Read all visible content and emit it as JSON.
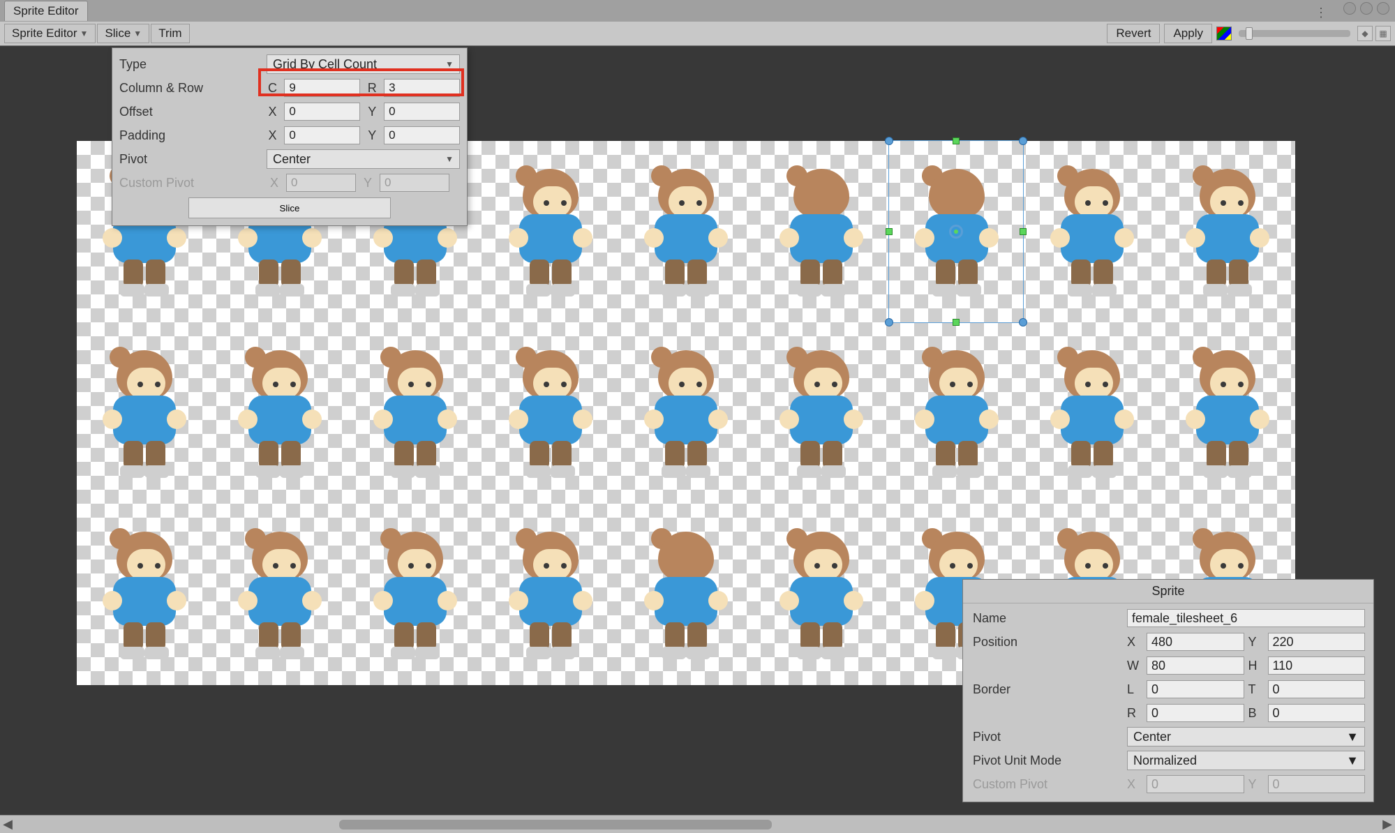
{
  "tabs": {
    "main": "Sprite Editor"
  },
  "toolbar": {
    "sprite_editor": "Sprite Editor",
    "slice": "Slice",
    "trim": "Trim",
    "revert": "Revert",
    "apply": "Apply"
  },
  "slice_popup": {
    "type_label": "Type",
    "type_value": "Grid By Cell Count",
    "col_row_label": "Column & Row",
    "col_prefix": "C",
    "col_value": "9",
    "row_prefix": "R",
    "row_value": "3",
    "offset_label": "Offset",
    "offset_x": "0",
    "offset_y": "0",
    "padding_label": "Padding",
    "padding_x": "0",
    "padding_y": "0",
    "pivot_label": "Pivot",
    "pivot_value": "Center",
    "custom_pivot_label": "Custom Pivot",
    "custom_x": "0",
    "custom_y": "0",
    "x_prefix": "X",
    "y_prefix": "Y",
    "slice_button": "Slice"
  },
  "inspector": {
    "title": "Sprite",
    "name_label": "Name",
    "name_value": "female_tilesheet_6",
    "position_label": "Position",
    "X": "X",
    "Y": "Y",
    "W": "W",
    "H": "H",
    "pos_x": "480",
    "pos_y": "220",
    "pos_w": "80",
    "pos_h": "110",
    "border_label": "Border",
    "L": "L",
    "T": "T",
    "R": "R",
    "B": "B",
    "border_l": "0",
    "border_t": "0",
    "border_r": "0",
    "border_b": "0",
    "pivot_label": "Pivot",
    "pivot_value": "Center",
    "pivot_unit_label": "Pivot Unit Mode",
    "pivot_unit_value": "Normalized",
    "custom_pivot_label": "Custom Pivot",
    "custom_x": "0",
    "custom_y": "0"
  }
}
